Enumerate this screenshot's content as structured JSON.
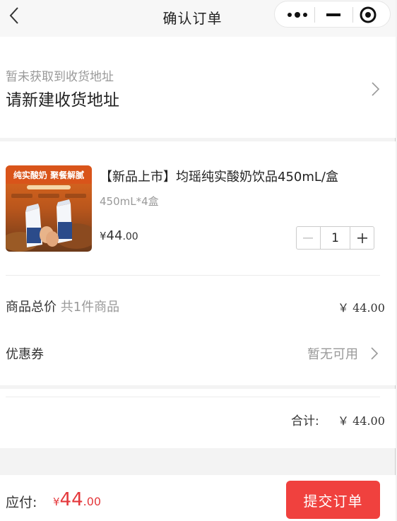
{
  "nav": {
    "title": "确认订单"
  },
  "address": {
    "hint": "暂未获取到收货地址",
    "action": "请新建收货地址"
  },
  "product": {
    "title": "【新品上市】均瑶纯实酸奶饮品450mL/盒",
    "spec": "450mL*4盒",
    "price_currency": "¥",
    "price_integer": "44",
    "price_decimal": ".00",
    "quantity": "1",
    "image_text": "纯实酸奶 聚餐解腻"
  },
  "summary": {
    "goods_total_label": "商品总价",
    "goods_count": "共1件商品",
    "goods_total_value": "￥ 44.00",
    "coupon_label": "优惠券",
    "coupon_value": "暂无可用",
    "total_label": "合计:",
    "total_value": "￥ 44.00"
  },
  "footer": {
    "pay_label": "应付:",
    "currency": "¥",
    "amount_integer": "44",
    "amount_decimal": ".00",
    "submit_label": "提交订单"
  },
  "colors": {
    "accent": "#f0413e",
    "price": "#e4393c",
    "muted": "#999999"
  },
  "icons": [
    "back-icon",
    "more-icon",
    "minimize-icon",
    "close-target-icon",
    "chevron-right-icon"
  ]
}
